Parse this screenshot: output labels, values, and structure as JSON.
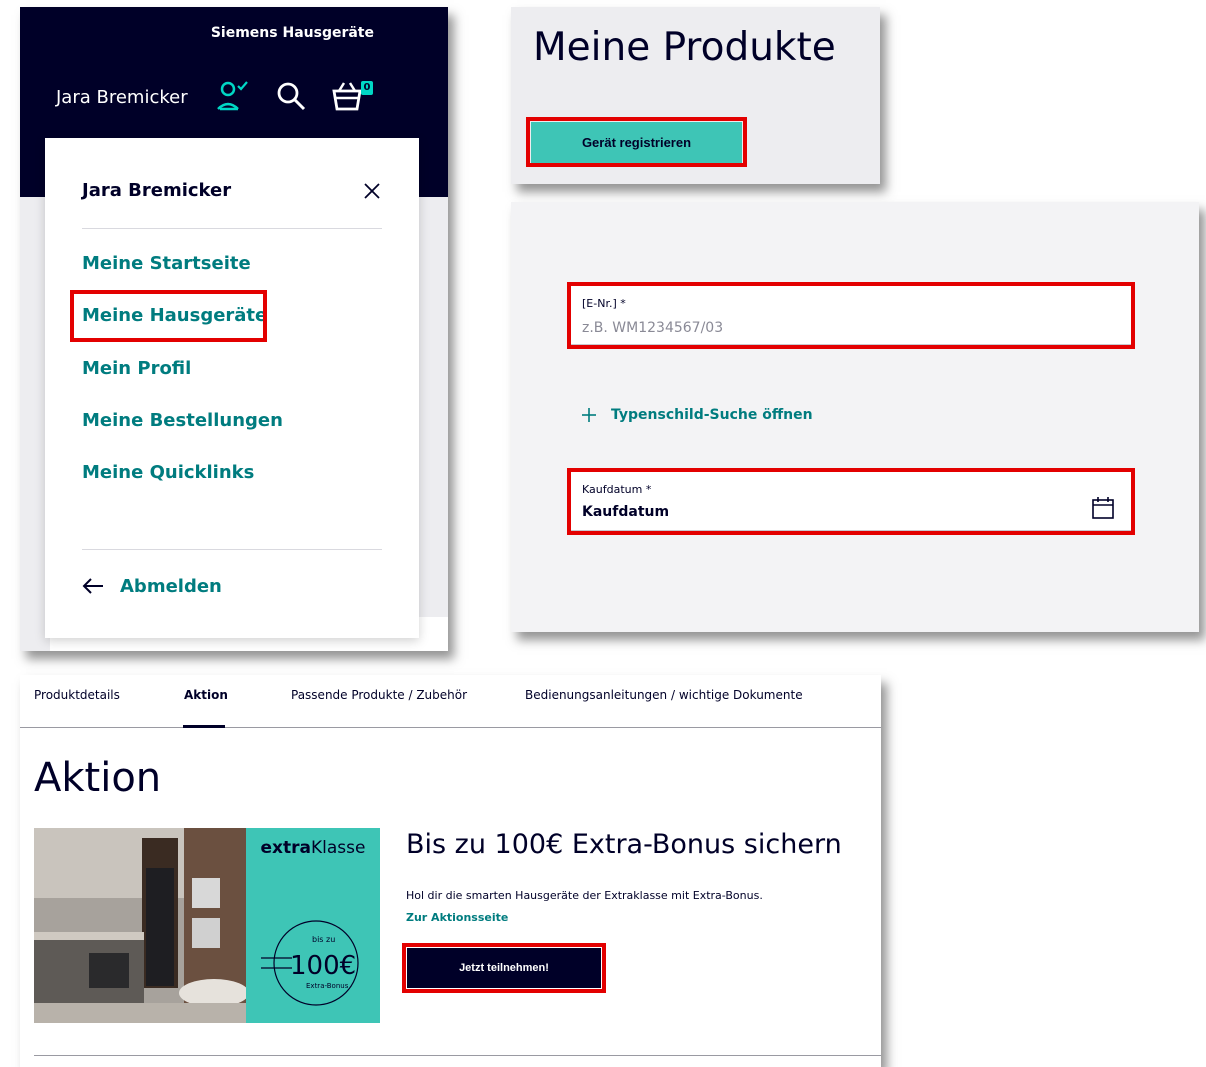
{
  "account_panel": {
    "brand": "Siemens Hausgeräte",
    "user_name": "Jara Bremicker",
    "basket_count": "0",
    "menu": {
      "title": "Jara Bremicker",
      "items": [
        {
          "label": "Meine Startseite"
        },
        {
          "label": "Meine Hausgeräte"
        },
        {
          "label": "Mein Profil"
        },
        {
          "label": "Meine Bestellungen"
        },
        {
          "label": "Meine Quicklinks"
        }
      ],
      "logout_label": "Abmelden"
    }
  },
  "products_panel": {
    "title": "Meine Produkte",
    "register_button": "Gerät registrieren"
  },
  "register_form": {
    "enr_label": "[E-Nr.] *",
    "enr_placeholder": "z.B. WM1234567/03",
    "typenschild_link": "Typenschild-Suche öffnen",
    "date_label": "Kaufdatum *",
    "date_value": "Kaufdatum"
  },
  "aktion_panel": {
    "tabs": [
      {
        "label": "Produktdetails"
      },
      {
        "label": "Aktion"
      },
      {
        "label": "Passende Produkte / Zubehör"
      },
      {
        "label": "Bedienungsanleitungen / wichtige Dokumente"
      }
    ],
    "heading": "Aktion",
    "promo": {
      "brand_bold": "extra",
      "brand_regular": "Klasse",
      "badge_top": "bis zu",
      "badge_amount": "100€",
      "badge_bottom": "Extra-Bonus",
      "title": "Bis zu 100€ Extra-Bonus sichern",
      "description": "Hol dir die smarten Hausgeräte der Extraklasse mit Extra-Bonus.",
      "link": "Zur Aktionsseite",
      "cta": "Jetzt teilnehmen!"
    }
  },
  "colors": {
    "navy": "#000028",
    "teal_button": "#3ec5b6",
    "teal_text": "#007c7f",
    "highlight_red": "#e30000"
  }
}
